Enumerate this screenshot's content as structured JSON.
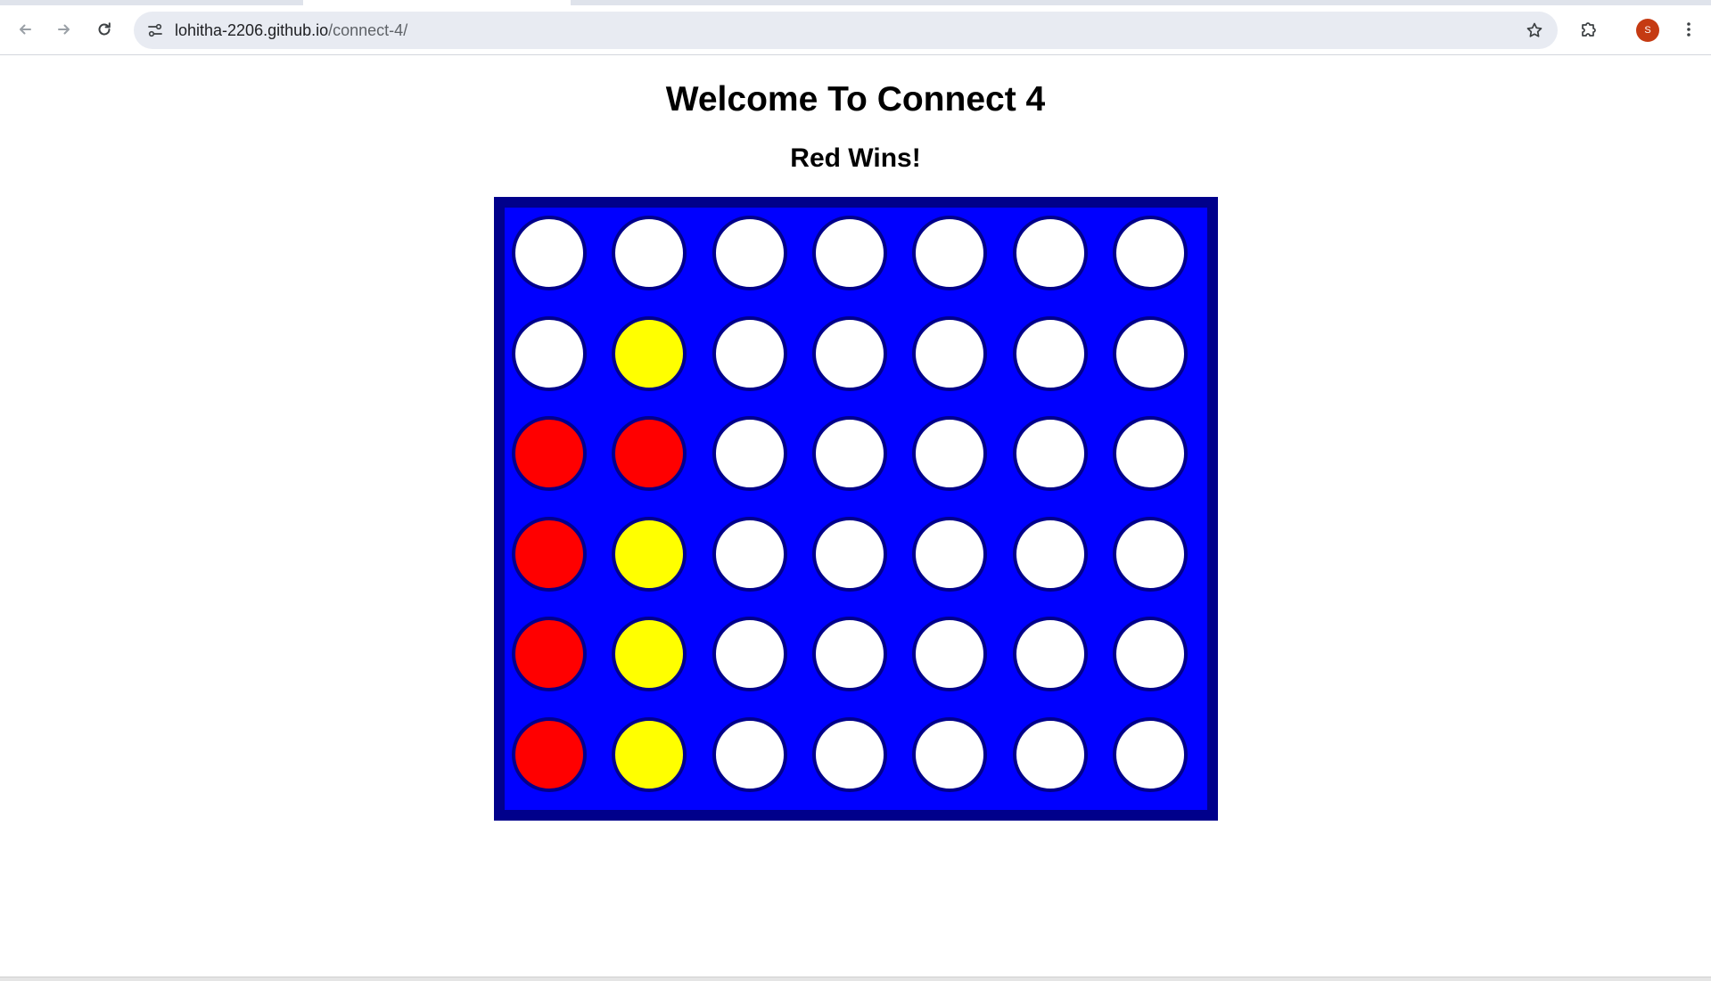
{
  "browser": {
    "url_host": "lohitha-2206.github.io",
    "url_path": "/connect-4/",
    "profile_initial": "S",
    "icons": {
      "back": "arrow-left-icon",
      "forward": "arrow-right-icon",
      "reload": "reload-icon",
      "site_info": "tune-icon",
      "bookmark": "star-icon",
      "extensions": "puzzle-icon",
      "menu": "more-vert-icon"
    }
  },
  "page": {
    "title": "Welcome To Connect 4",
    "status": "Red Wins!"
  },
  "board": {
    "rows": 6,
    "columns": 7,
    "colors": {
      "frame": "#00008b",
      "background": "#0000ff",
      "empty": "#ffffff",
      "red": "#ff0000",
      "yellow": "#ffff00"
    },
    "cells": [
      [
        "empty",
        "empty",
        "empty",
        "empty",
        "empty",
        "empty",
        "empty"
      ],
      [
        "empty",
        "yellow",
        "empty",
        "empty",
        "empty",
        "empty",
        "empty"
      ],
      [
        "red",
        "red",
        "empty",
        "empty",
        "empty",
        "empty",
        "empty"
      ],
      [
        "red",
        "yellow",
        "empty",
        "empty",
        "empty",
        "empty",
        "empty"
      ],
      [
        "red",
        "yellow",
        "empty",
        "empty",
        "empty",
        "empty",
        "empty"
      ],
      [
        "red",
        "yellow",
        "empty",
        "empty",
        "empty",
        "empty",
        "empty"
      ]
    ]
  }
}
